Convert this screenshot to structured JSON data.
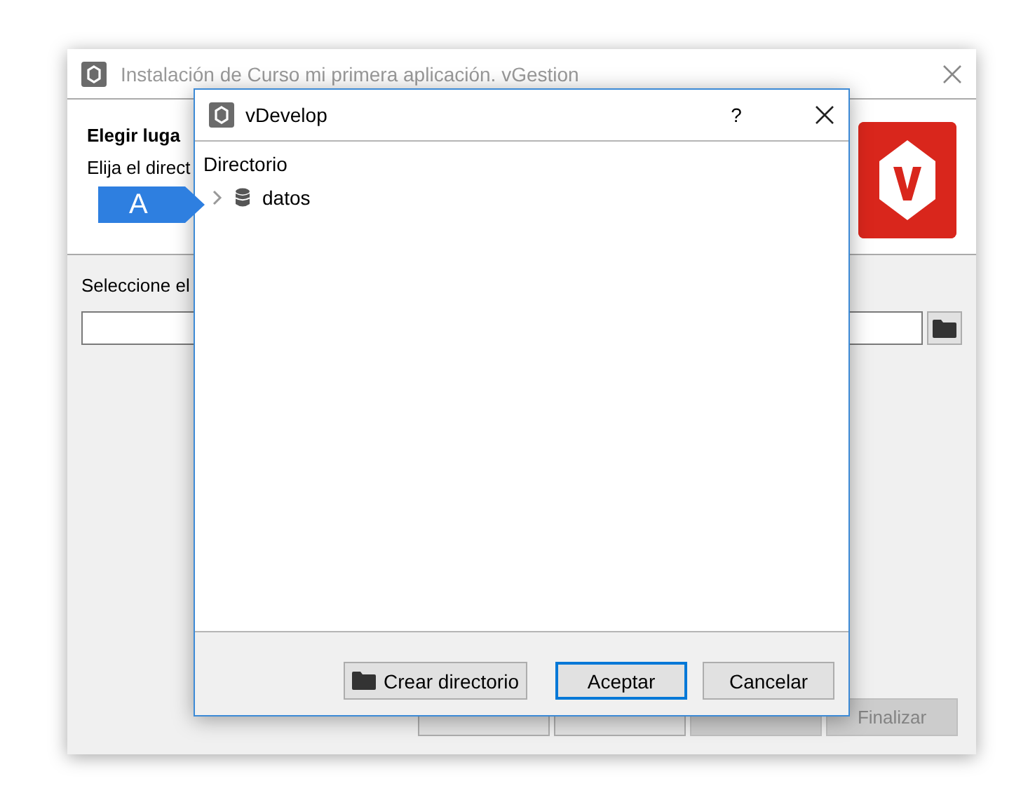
{
  "window": {
    "title": "Instalación de Curso mi primera aplicación. vGestion"
  },
  "header": {
    "title": "Elegir luga",
    "subtitle": "Elija el direct"
  },
  "location": {
    "label": "Seleccione el"
  },
  "buttons": [
    {
      "disabled": false
    },
    {
      "disabled": false
    },
    {
      "disabled": true
    },
    {
      "label": "Finalizar",
      "disabled": true
    }
  ],
  "dialog": {
    "title": "vDevelop",
    "help": "?",
    "tree_header": "Directorio",
    "tree": [
      {
        "label": "datos",
        "expanded": false
      }
    ],
    "buttons": [
      {
        "label": "Crear directorio",
        "kind": "folder",
        "default": false
      },
      {
        "label": "Aceptar",
        "kind": "plain",
        "default": true
      },
      {
        "label": "Cancelar",
        "kind": "plain",
        "default": false
      }
    ]
  },
  "callout": {
    "label": "A"
  }
}
